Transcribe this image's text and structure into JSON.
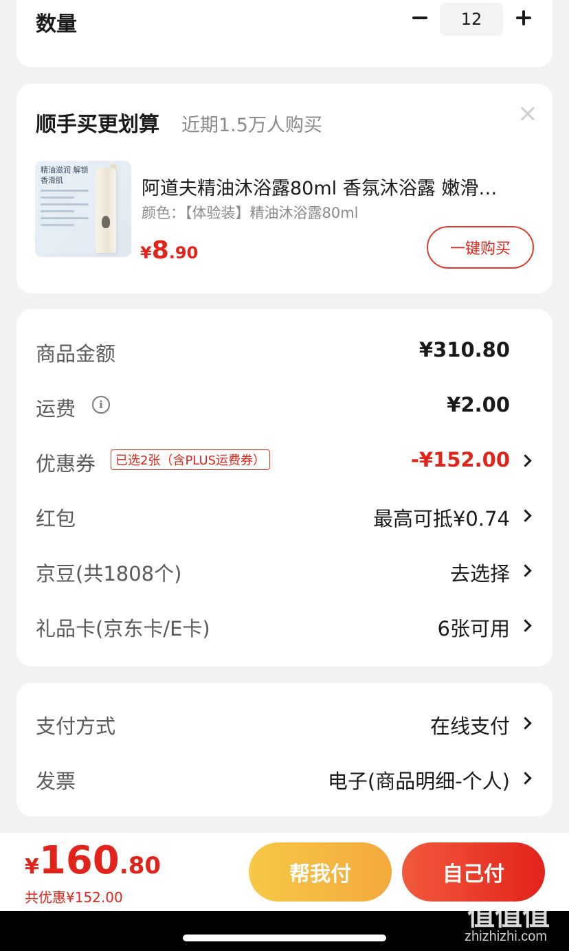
{
  "quantity": {
    "label": "数量",
    "value": "12"
  },
  "recommendation": {
    "title": "顺手买更划算",
    "subtitle": "近期1.5万人购买",
    "product": {
      "image_text": "精油滋润 解锁香滑肌",
      "name": "阿道夫精油沐浴露80ml 香氛沐浴露 嫩滑…",
      "color": "颜色：【体验装】精油沐浴露80ml",
      "price_currency": "¥",
      "price_int": "8",
      "price_dec": ".90",
      "buy_button": "一键购买"
    }
  },
  "summary": {
    "rows": [
      {
        "label": "商品金额",
        "value": "¥310.80"
      },
      {
        "label": "运费",
        "value": "¥2.00",
        "info_icon": "i"
      },
      {
        "label": "优惠券",
        "tag": "已选2张（含PLUS运费券）",
        "value": "-¥152.00"
      },
      {
        "label": "红包",
        "value": "最高可抵¥0.74"
      },
      {
        "label": "京豆(共1808个)",
        "value": "去选择"
      },
      {
        "label": "礼品卡(京东卡/E卡)",
        "value": "6张可用"
      }
    ]
  },
  "payment": {
    "rows": [
      {
        "label": "支付方式",
        "value": "在线支付"
      },
      {
        "label": "发票",
        "value": "电子(商品明细-个人)"
      }
    ]
  },
  "bottom": {
    "total_currency": "¥",
    "total_int": "160",
    "total_dec": ".80",
    "discount_text": "共优惠¥152.00",
    "help_pay": "帮我付",
    "self_pay": "自己付"
  },
  "watermark": {
    "logo": "值值值",
    "site": "zhizhizhi.com"
  },
  "colors": {
    "accent_red": "#e2231a",
    "help_button": "#f2a93b",
    "background": "#f2f2f2"
  }
}
